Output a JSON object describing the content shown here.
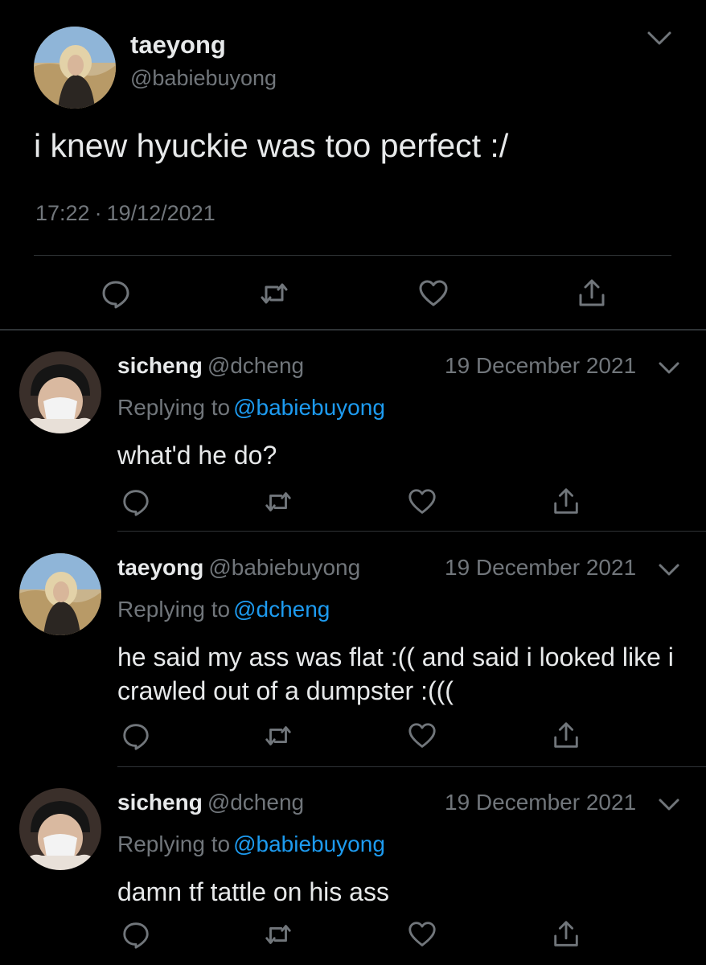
{
  "main_tweet": {
    "display_name": "taeyong",
    "handle": "@babiebuyong",
    "text": "i knew hyuckie was too perfect :/",
    "time": "17:22",
    "separator": "·",
    "date": "19/12/2021"
  },
  "replies": [
    {
      "display_name": "sicheng",
      "handle": "@dcheng",
      "date": "19 December 2021",
      "replying_label": "Replying to",
      "replying_to": "@babiebuyong",
      "text": "what'd he do?"
    },
    {
      "display_name": "taeyong",
      "handle": "@babiebuyong",
      "date": "19 December 2021",
      "replying_label": "Replying to",
      "replying_to": "@dcheng",
      "text": "he said my ass was flat :(( and said i looked like i crawled out of a dumpster :((("
    },
    {
      "display_name": "sicheng",
      "handle": "@dcheng",
      "date": "19 December 2021",
      "replying_label": "Replying to",
      "replying_to": "@babiebuyong",
      "text": "damn tf tattle on his ass"
    }
  ],
  "icons": {
    "reply": "reply-icon",
    "retweet": "retweet-icon",
    "like": "heart-icon",
    "share": "share-icon",
    "more": "chevron-down-icon"
  },
  "colors": {
    "background": "#000000",
    "text": "#e7e9ea",
    "muted": "#71767b",
    "link": "#1d9bf0",
    "divider": "#2f3336"
  }
}
